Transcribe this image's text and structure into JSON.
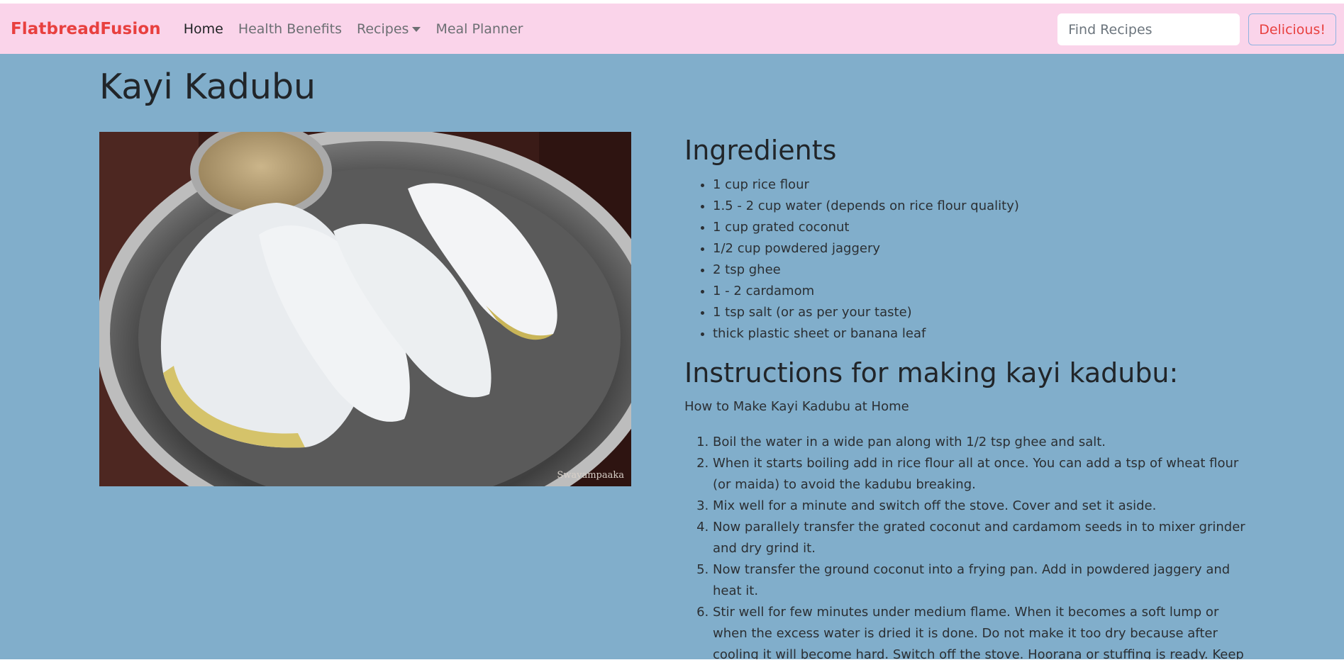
{
  "navbar": {
    "brand": "FlatbreadFusion",
    "links": [
      {
        "label": "Home"
      },
      {
        "label": "Health Benefits"
      },
      {
        "label": "Recipes"
      },
      {
        "label": "Meal Planner"
      }
    ],
    "search_placeholder": "Find Recipes",
    "button_label": "Delicious!"
  },
  "recipe": {
    "title": "Kayi Kadubu",
    "photo_watermark": "Swayampaaka",
    "ingredients_heading": "Ingredients",
    "ingredients": [
      "1 cup rice flour",
      "1.5 - 2 cup water (depends on rice flour quality)",
      "1 cup grated coconut",
      "1/2 cup powdered jaggery",
      "2 tsp ghee",
      "1 - 2 cardamom",
      "1 tsp salt (or as per your taste)",
      "thick plastic sheet or banana leaf"
    ],
    "instructions_heading": "Instructions for making kayi kadubu:",
    "instructions_subheading": "How to Make Kayi Kadubu at Home",
    "steps": [
      "Boil the water in a wide pan along with 1/2 tsp ghee and salt.",
      "When it starts boiling add in rice flour all at once. You can add a tsp of wheat flour (or maida) to avoid the kadubu breaking.",
      "Mix well for a minute and switch off the stove. Cover and set it aside.",
      "Now parallely transfer the grated coconut and cardamom seeds in to mixer grinder and dry grind it.",
      "Now transfer the ground coconut into a frying pan. Add in powdered jaggery and heat it.",
      "Stir well for few minutes under medium flame. When it becomes a soft lump or when the excess water is dried it is done. Do not make it too dry because after cooling it will become hard. Switch off the stove. Hoorana or stuffing is ready. Keep it aside."
    ]
  },
  "colors": {
    "page_bg": "#81aecb",
    "navbar_bg": "#fad4ea",
    "brand": "#e8403f"
  }
}
